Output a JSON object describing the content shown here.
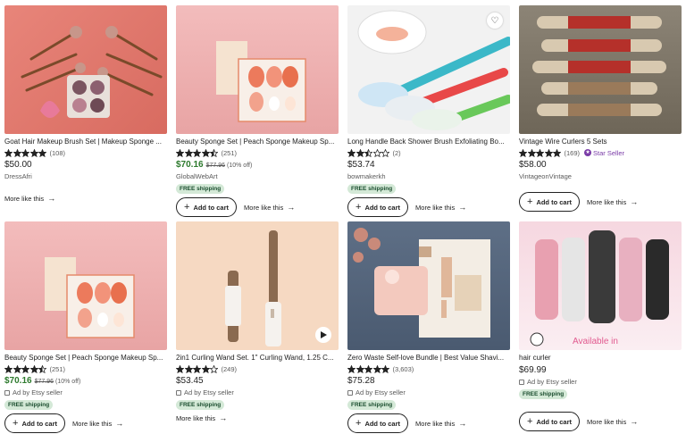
{
  "listings": [
    {
      "title": "Goat Hair Makeup Brush Set | Makeup Sponge ...",
      "rating": 5,
      "reviews": "(108)",
      "price": "$50.00",
      "shop": "DressAfri",
      "more_label": "More like this"
    },
    {
      "title": "Beauty Sponge Set | Peach Sponge Makeup Sp...",
      "rating": 4.5,
      "reviews": "(251)",
      "price": "$70.16",
      "original_price": "$77.96",
      "discount": "(10% off)",
      "shop": "GlobalWebArt",
      "shipping": "FREE shipping",
      "cart_label": "Add to cart",
      "more_label": "More like this"
    },
    {
      "title": "Long Handle Back Shower Brush Exfoliating Bo...",
      "rating": 2.5,
      "reviews": "(2)",
      "price": "$53.74",
      "shop": "bowmakerkh",
      "shipping": "FREE shipping",
      "cart_label": "Add to cart",
      "more_label": "More like this"
    },
    {
      "title": "Vintage Wire Curlers 5 Sets",
      "rating": 5,
      "reviews": "(169)",
      "star_seller": "Star Seller",
      "price": "$58.00",
      "shop": "VintageonVintage",
      "cart_label": "Add to cart",
      "more_label": "More like this"
    },
    {
      "title": "Beauty Sponge Set | Peach Sponge Makeup Sp...",
      "rating": 4.5,
      "reviews": "(251)",
      "price": "$70.16",
      "original_price": "$77.96",
      "discount": "(10% off)",
      "ad": "Ad by Etsy seller",
      "shipping": "FREE shipping",
      "cart_label": "Add to cart",
      "more_label": "More like this"
    },
    {
      "title": "2in1 Curling Wand Set. 1\" Curling Wand, 1.25 C...",
      "rating": 4,
      "reviews": "(249)",
      "price": "$53.45",
      "ad": "Ad by Etsy seller",
      "shipping": "FREE shipping",
      "more_label": "More like this"
    },
    {
      "title": "Zero Waste Self-love Bundle | Best Value Shavi...",
      "rating": 5,
      "reviews": "(3,603)",
      "price": "$75.28",
      "ad": "Ad by Etsy seller",
      "shipping": "FREE shipping",
      "cart_label": "Add to cart",
      "more_label": "More like this"
    },
    {
      "title": "hair curler",
      "price": "$69.99",
      "ad": "Ad by Etsy seller",
      "shipping": "FREE shipping",
      "cart_label": "Add to cart",
      "more_label": "More like this",
      "image_overlay": "Available in"
    }
  ],
  "colors": {
    "sale_green": "#2d7a2d",
    "shipping_bg": "#d4e9d7",
    "star_black": "#222222",
    "star_seller_purple": "#7a3ba7"
  },
  "icons": {
    "star": "star-icon",
    "heart": "heart-icon",
    "play": "play-icon",
    "arrow": "arrow-right-icon",
    "plus": "plus-icon"
  }
}
